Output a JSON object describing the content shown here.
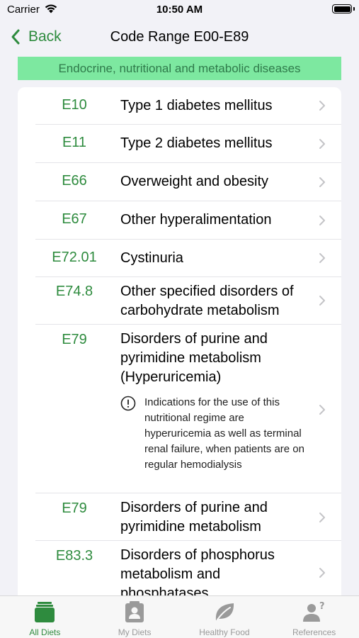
{
  "status_bar": {
    "carrier": "Carrier",
    "time": "10:50 AM"
  },
  "nav": {
    "back_label": "Back",
    "title": "Code Range E00-E89"
  },
  "category": "Endocrine, nutritional and metabolic diseases",
  "accent_color": "#2e8b3e",
  "banner_color": "#7de8a0",
  "rows": [
    {
      "code": "E10",
      "description": "Type 1 diabetes mellitus"
    },
    {
      "code": "E11",
      "description": "Type 2 diabetes mellitus"
    },
    {
      "code": "E66",
      "description": "Overweight and obesity"
    },
    {
      "code": "E67",
      "description": "Other hyperalimentation"
    },
    {
      "code": "E72.01",
      "description": "Cystinuria"
    },
    {
      "code": "E74.8",
      "description": "Other specified disorders of carbohydrate metabolism"
    },
    {
      "code": "E79",
      "description": "Disorders of purine and pyrimidine metabolism (Hyperuricemia)",
      "note": "Indications for the use of this nutritional regime are hyperuricemia as well as terminal renal failure, when patients are on regular hemodialysis"
    },
    {
      "code": "E79",
      "description": "Disorders of purine and pyrimidine metabolism"
    },
    {
      "code": "E83.3",
      "description": "Disorders of phosphorus metabolism and phosphatases"
    }
  ],
  "tabs": [
    {
      "label": "All Diets",
      "icon": "diets-stack-icon",
      "active": true
    },
    {
      "label": "My Diets",
      "icon": "person-badge-icon",
      "active": false
    },
    {
      "label": "Healthy Food",
      "icon": "leaf-icon",
      "active": false
    },
    {
      "label": "References",
      "icon": "person-question-icon",
      "active": false
    }
  ]
}
